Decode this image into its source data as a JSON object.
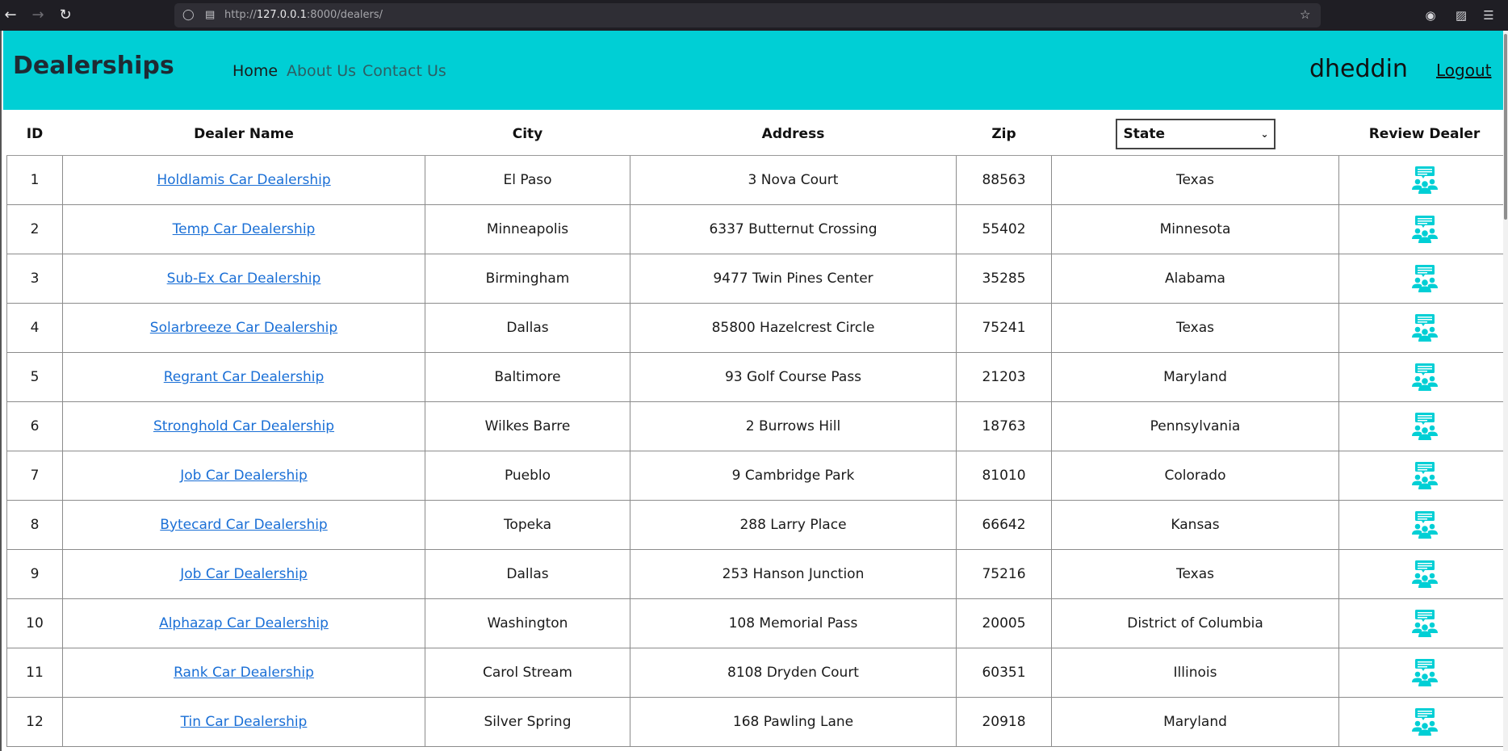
{
  "browser": {
    "url_prefix": "http://",
    "url_host": "127.0.0.1",
    "url_rest": ":8000/dealers/"
  },
  "navbar": {
    "brand": "Dealerships",
    "links": [
      "Home",
      "About Us",
      "Contact Us"
    ],
    "username": "dheddin",
    "logout": "Logout",
    "color": "#00cfd5"
  },
  "table": {
    "headers": {
      "id": "ID",
      "name": "Dealer Name",
      "city": "City",
      "address": "Address",
      "zip": "Zip",
      "state_select": "State",
      "review": "Review Dealer"
    },
    "rows": [
      {
        "id": "1",
        "name": "Holdlamis Car Dealership",
        "city": "El Paso",
        "address": "3 Nova Court",
        "zip": "88563",
        "state": "Texas"
      },
      {
        "id": "2",
        "name": "Temp Car Dealership",
        "city": "Minneapolis",
        "address": "6337 Butternut Crossing",
        "zip": "55402",
        "state": "Minnesota"
      },
      {
        "id": "3",
        "name": "Sub-Ex Car Dealership",
        "city": "Birmingham",
        "address": "9477 Twin Pines Center",
        "zip": "35285",
        "state": "Alabama"
      },
      {
        "id": "4",
        "name": "Solarbreeze Car Dealership",
        "city": "Dallas",
        "address": "85800 Hazelcrest Circle",
        "zip": "75241",
        "state": "Texas"
      },
      {
        "id": "5",
        "name": "Regrant Car Dealership",
        "city": "Baltimore",
        "address": "93 Golf Course Pass",
        "zip": "21203",
        "state": "Maryland"
      },
      {
        "id": "6",
        "name": "Stronghold Car Dealership",
        "city": "Wilkes Barre",
        "address": "2 Burrows Hill",
        "zip": "18763",
        "state": "Pennsylvania"
      },
      {
        "id": "7",
        "name": "Job Car Dealership",
        "city": "Pueblo",
        "address": "9 Cambridge Park",
        "zip": "81010",
        "state": "Colorado"
      },
      {
        "id": "8",
        "name": "Bytecard Car Dealership",
        "city": "Topeka",
        "address": "288 Larry Place",
        "zip": "66642",
        "state": "Kansas"
      },
      {
        "id": "9",
        "name": "Job Car Dealership",
        "city": "Dallas",
        "address": "253 Hanson Junction",
        "zip": "75216",
        "state": "Texas"
      },
      {
        "id": "10",
        "name": "Alphazap Car Dealership",
        "city": "Washington",
        "address": "108 Memorial Pass",
        "zip": "20005",
        "state": "District of Columbia"
      },
      {
        "id": "11",
        "name": "Rank Car Dealership",
        "city": "Carol Stream",
        "address": "8108 Dryden Court",
        "zip": "60351",
        "state": "Illinois"
      },
      {
        "id": "12",
        "name": "Tin Car Dealership",
        "city": "Silver Spring",
        "address": "168 Pawling Lane",
        "zip": "20918",
        "state": "Maryland"
      }
    ],
    "review_icon": "review-people-icon",
    "icon_color": "#00cfd5",
    "link_color": "#1a6fd6"
  }
}
